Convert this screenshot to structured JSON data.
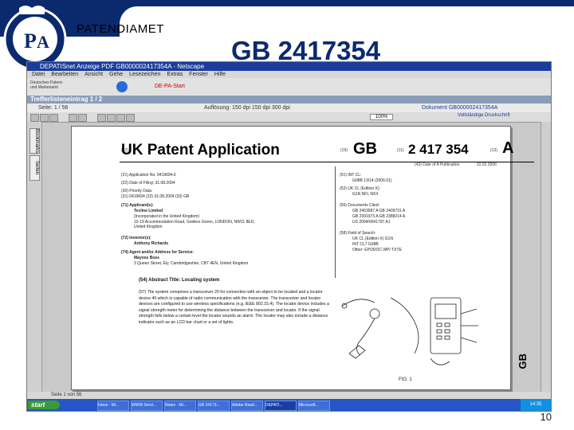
{
  "slide": {
    "brand": "PATENDIAMET",
    "title": "GB 2417354",
    "page_number": "10"
  },
  "browser": {
    "window_title": "DEPATISnet Anzeige PDF GB000002417354A - Netscape",
    "menu_items": [
      "Datei",
      "Bearbeiten",
      "Ansicht",
      "Gehe",
      "Lesezeichen",
      "Extras",
      "Fenster",
      "Hilfe"
    ],
    "header_left_logo_text": "Deutsches Patent- und Markenamt",
    "header_red_text": "DE-PA-Start",
    "result_list": "Trefferlisteneintrag 1 / 2",
    "page_info": "Seite: 1 / 56",
    "zoom_label": "Auflösung: 150 dpi 150 dpi 300 dpi",
    "document_id": "Dokument GB000002417354A",
    "full_text_link": "Vollständige Druckschrift",
    "zoom_value": "100%",
    "left_tabs": [
      "Bookmarks",
      "Seiten"
    ],
    "status_text": "Seite 1 von 56",
    "taskbar": {
      "start": "start",
      "tasks": [
        "Inbox - Mi...",
        "WWW Servi...",
        "Notes - Mi...",
        "GB 24173...",
        "Adobe Read...",
        "DEPATI...",
        "Microsoft..."
      ],
      "clock": "14:35"
    }
  },
  "document": {
    "app_title": "UK Patent Application",
    "gb_prefix": "GB",
    "pub_number": "2 417 354",
    "kind_code": "A",
    "pub_date_label": "(43) Date of A Publication",
    "pub_date": "22.02.2006",
    "left_fields": [
      "(21) Application No: 0419694.6",
      "(22) Date of Filing: 31.08.2004",
      "(30) Priority Data:",
      "(31) 0419694 (32) 31.08.2004 (33) GB",
      "(71) Applicant(s):",
      "Tecline Limited",
      "(Incorporated in the United Kingdom)",
      "15-19 Accommodation Road, Golders Green, LONDON, NW11 8ED, United Kingdom",
      "(72) Inventor(s):",
      "Anthony Richards",
      "(74) Agent and/or Address for Service:",
      "Mayoss Buss",
      "3 Queen Street, Ely, Cambridgeshire, CB7 4EN, United Kingdom"
    ],
    "right_fields": [
      "(51) INT CL:",
      "G08B 13/14 (2006.01)",
      "(52) UK CL (Edition X):",
      "G1N NFL NXX",
      "(56) Documents Cited:",
      "GB 2403587 A   GB 2409731 A",
      "GB 2391973 A   GB 2388214 A",
      "US 2004/0041797 A1",
      "(58) Field of Search:",
      "UK CL (Edition X) G1N",
      "INT CL7 G08B",
      "Other: EPODOC WPI TXTE"
    ],
    "abstract_title": "(54) Abstract Title: Locating system",
    "abstract_text": "(57) The system comprises a transceiver 20 for connection with an object to be located and a locator device 40 which is capable of radio communication with the transceiver. The transceiver and locator devices are configured to use wireless specifications (e.g. IEEE 802.15.4). The locator device includes a signal strength meter for determining the distance between the transceiver and locator. If the signal strength falls below a certain level the locator sounds an alarm. The locator may also include a distance indicator such as an LCD bar chart or a set of lights.",
    "side_label": "GB",
    "figure_label": "FIG. 1"
  },
  "colors": {
    "slide_blue": "#0b2a6e",
    "window_title_blue": "#1a3d9c",
    "taskbar_blue": "#2456c8"
  }
}
